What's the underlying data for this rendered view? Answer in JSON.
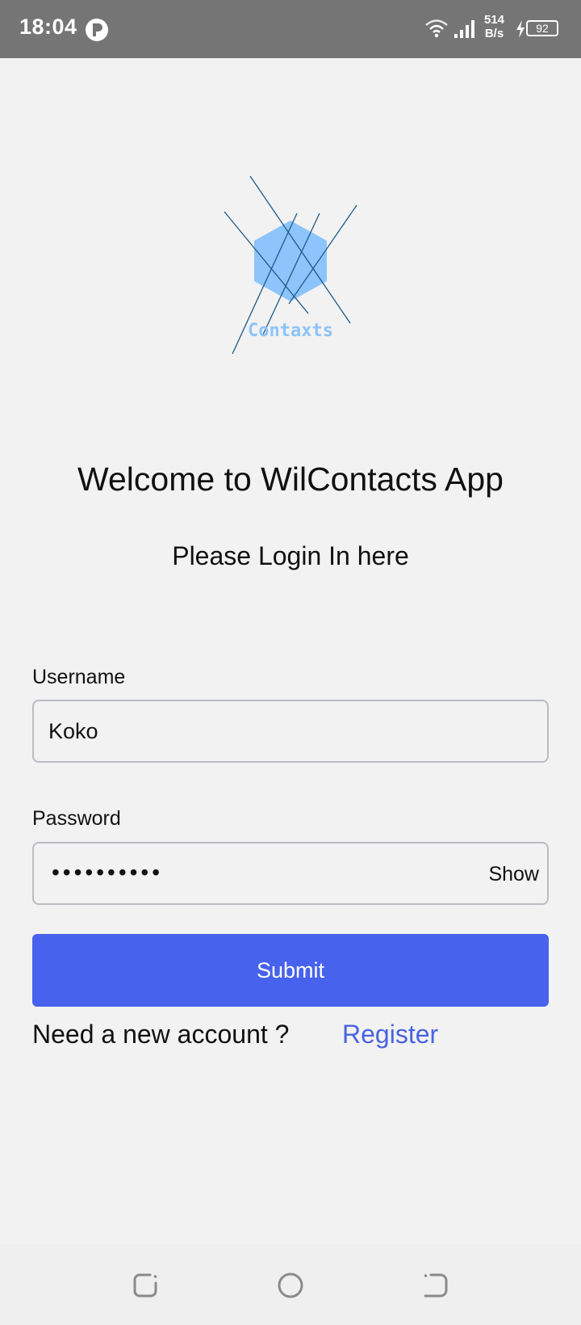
{
  "status_bar": {
    "time": "18:04",
    "net_speed_value": "514",
    "net_speed_unit": "B/s",
    "battery_level": "92"
  },
  "logo": {
    "text": "Contaxts",
    "hexagon_color": "#8cc4fb",
    "line_color": "#1f5a86"
  },
  "welcome": {
    "title": "Welcome to WilContacts App",
    "subtitle": "Please Login In here"
  },
  "form": {
    "username_label": "Username",
    "username_value": "Koko",
    "password_label": "Password",
    "password_masked": "••••••••••",
    "show_label": "Show",
    "submit_label": "Submit"
  },
  "footer": {
    "need_account_text": "Need a new account ?",
    "register_label": "Register"
  },
  "colors": {
    "accent": "#4762ec",
    "link": "#4a63e0",
    "background": "#f2f2f2",
    "status_bar": "#757575"
  },
  "nav_bar": {
    "icons": [
      "recents-icon",
      "home-icon",
      "back-icon"
    ]
  }
}
